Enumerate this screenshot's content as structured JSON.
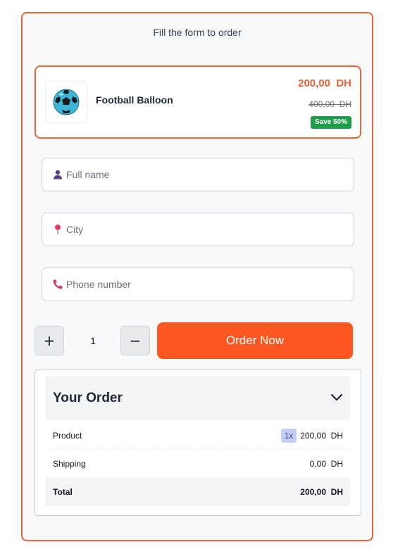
{
  "form": {
    "heading": "Fill the form to order"
  },
  "product": {
    "name": "Football Balloon",
    "price": "200,00  DH",
    "old_price": "400,00  DH",
    "save_badge": "Save 50%"
  },
  "fields": {
    "full_name_placeholder": "Full name",
    "city_placeholder": "City",
    "phone_placeholder": "Phone number"
  },
  "quantity": {
    "plus": "+",
    "minus": "−",
    "value": "1"
  },
  "order_button": "Order Now",
  "summary": {
    "title": "Your Order",
    "rows": [
      {
        "label": "Product",
        "qty": "1x",
        "value": "200,00  DH"
      },
      {
        "label": "Shipping",
        "value": "0,00  DH"
      },
      {
        "label": "Total",
        "value": "200,00  DH"
      }
    ]
  },
  "colors": {
    "accent": "#e8643a",
    "button": "#ff5722",
    "badge": "#1f9d4a"
  },
  "icons": {
    "name_field": "user-icon",
    "city_field": "map-pin-icon",
    "phone_field": "phone-icon",
    "summary_toggle": "chevron-down-icon"
  }
}
